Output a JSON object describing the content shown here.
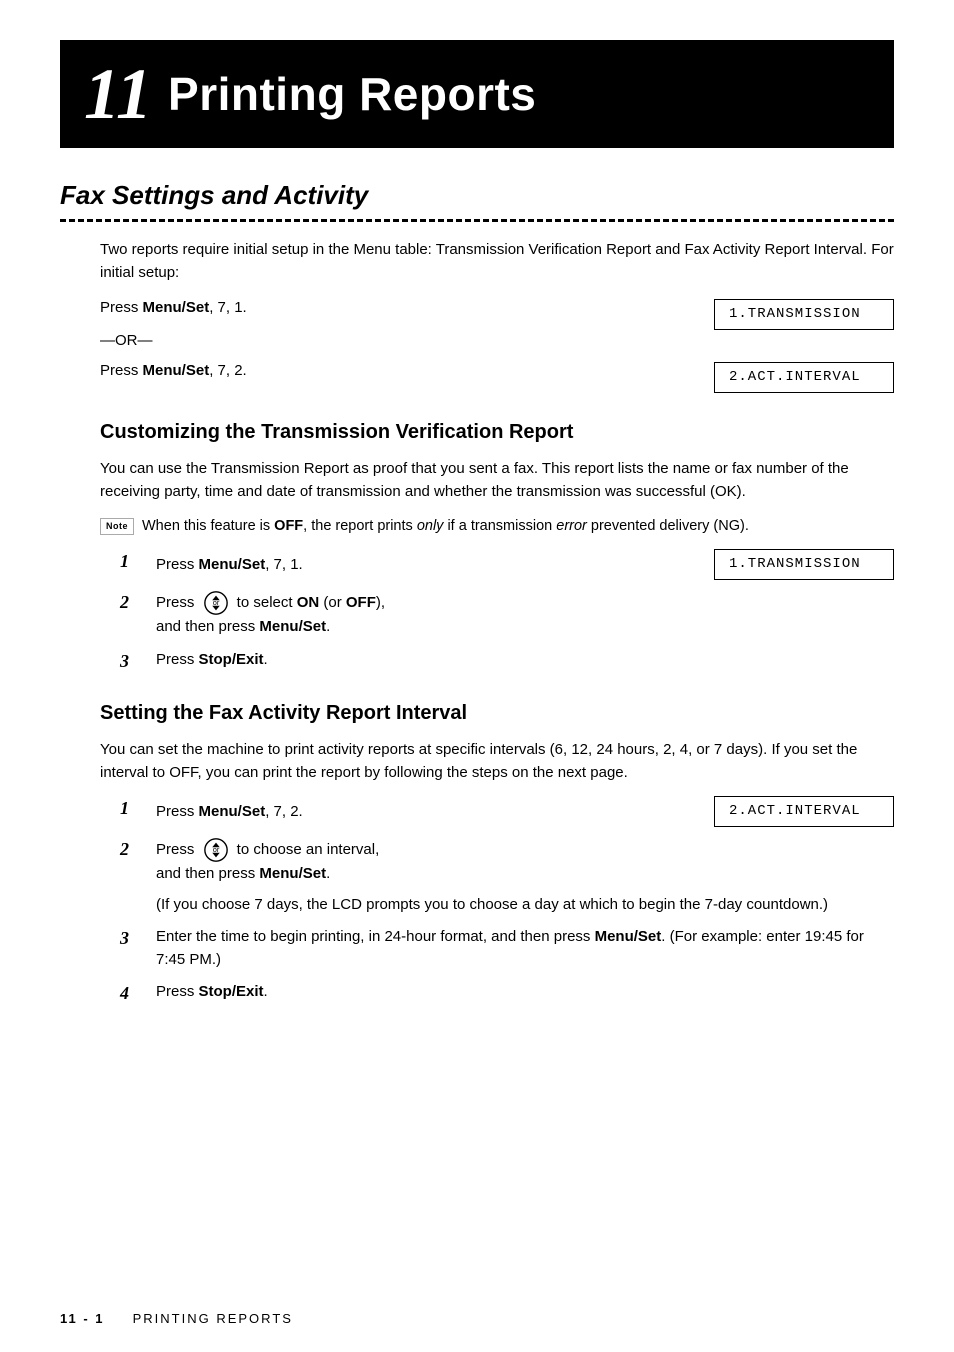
{
  "chapter": {
    "number": "11",
    "title": "Printing Reports"
  },
  "section": {
    "heading": "Fax Settings and Activity"
  },
  "intro_text": "Two reports require initial setup in the Menu table: Transmission Verification Report and Fax Activity Report Interval. For initial setup:",
  "press_block1": {
    "text_prefix": "Press ",
    "bold": "Menu/Set",
    "text_suffix": ", 7, 1.",
    "lcd": "1.TRANSMISSION"
  },
  "or_label": "—OR—",
  "press_block2": {
    "text_prefix": "Press ",
    "bold": "Menu/Set",
    "text_suffix": ", 7, 2.",
    "lcd": "2.ACT.INTERVAL"
  },
  "subsection1": {
    "heading": "Customizing the Transmission Verification Report",
    "body": "You can use the Transmission Report as proof that you sent a fax. This report lists the name or fax number of the receiving party, time and date of transmission and whether the transmission was successful (OK).",
    "note": {
      "badge": "Note",
      "text_prefix": "When this feature is ",
      "bold_off": "OFF",
      "text_mid": ", the report prints ",
      "italic_only": "only",
      "text_mid2": " if a transmission ",
      "italic_error": "error",
      "text_suffix": " prevented delivery (NG)."
    },
    "steps": [
      {
        "number": "1",
        "text_prefix": "Press ",
        "bold": "Menu/Set",
        "text_suffix": ", 7, 1.",
        "lcd": "1.TRANSMISSION"
      },
      {
        "number": "2",
        "line1_prefix": "Press ",
        "line1_mid": " to select ",
        "line1_bold1": "ON",
        "line1_text": " (or ",
        "line1_bold2": "OFF",
        "line1_suffix": "),",
        "line2_prefix": "and then press ",
        "line2_bold": "Menu/Set",
        "line2_suffix": "."
      },
      {
        "number": "3",
        "text_prefix": "Press ",
        "bold": "Stop/Exit",
        "text_suffix": "."
      }
    ]
  },
  "subsection2": {
    "heading": "Setting the Fax Activity Report Interval",
    "body": "You can set the machine to print activity reports at specific intervals (6, 12, 24 hours, 2, 4, or 7 days). If you set the interval to OFF, you can print the report by following the steps on the next page.",
    "steps": [
      {
        "number": "1",
        "text_prefix": "Press ",
        "bold": "Menu/Set",
        "text_suffix": ", 7, 2.",
        "lcd": "2.ACT.INTERVAL"
      },
      {
        "number": "2",
        "line1_prefix": "Press ",
        "line1_mid": " to choose an interval,",
        "line2_prefix": "and then press ",
        "line2_bold": "Menu/Set",
        "line2_suffix": ".",
        "extra": "(If you choose 7 days, the LCD prompts you to choose a day at which to begin the 7-day countdown.)"
      },
      {
        "number": "3",
        "text": "Enter the time to begin printing, in 24-hour format, and then press ",
        "bold": "Menu/Set",
        "text_suffix": ".",
        "extra": "(For example: enter 19:45 for 7:45 PM.)"
      },
      {
        "number": "4",
        "text_prefix": "Press ",
        "bold": "Stop/Exit",
        "text_suffix": "."
      }
    ]
  },
  "footer": {
    "page": "11 - 1",
    "label": "PRINTING REPORTS"
  }
}
